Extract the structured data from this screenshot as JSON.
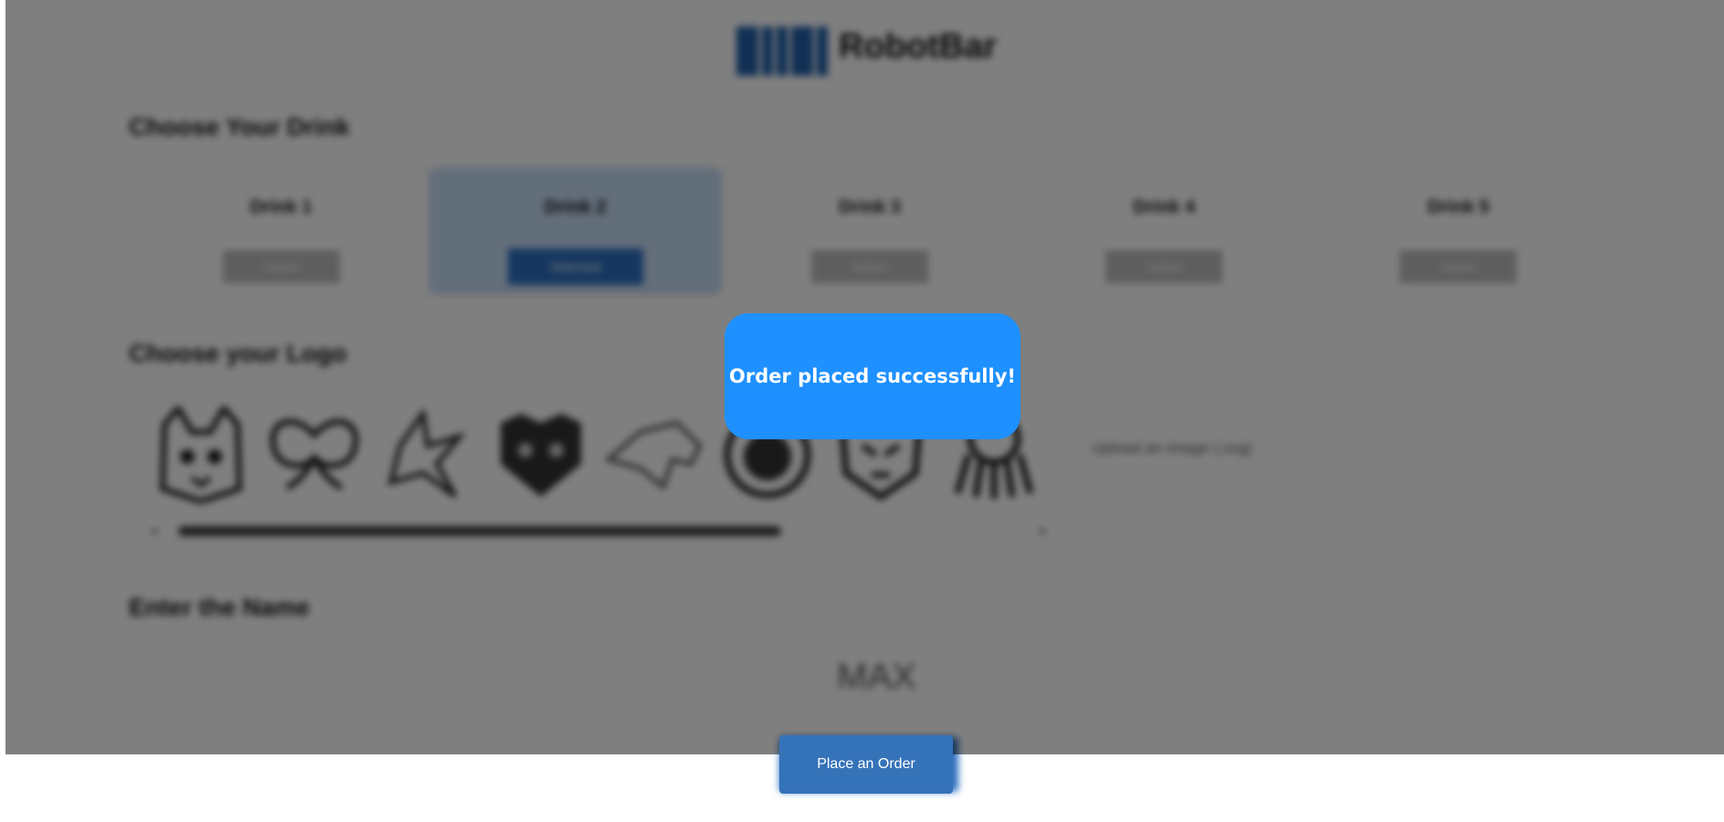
{
  "header": {
    "brand_logo": "tum-logo",
    "brand_name": "RobotBar"
  },
  "drinks_section": {
    "title": "Choose Your Drink",
    "items": [
      {
        "name": "Drink 1",
        "button_label": "Select",
        "selected": false
      },
      {
        "name": "Drink 2",
        "button_label": "Selected",
        "selected": true
      },
      {
        "name": "Drink 3",
        "button_label": "Select",
        "selected": false
      },
      {
        "name": "Drink 4",
        "button_label": "Select",
        "selected": false
      },
      {
        "name": "Drink 5",
        "button_label": "Select",
        "selected": false
      }
    ]
  },
  "logo_section": {
    "title": "Choose your Logo",
    "logos": [
      "cat-icon",
      "butterfly-icon",
      "bird-icon",
      "leopard-icon",
      "horse-icon",
      "lion-icon",
      "tiger-icon",
      "octopus-icon"
    ],
    "upload_hint": "Upload an image (.svg)"
  },
  "name_section": {
    "title": "Enter the Name",
    "value": "MAX"
  },
  "toast": {
    "message": "Order placed successfully!"
  },
  "actions": {
    "place_order_label": "Place an Order"
  },
  "colors": {
    "accent": "#2c6fc1",
    "toast_bg": "#1e90ff",
    "overlay": "rgba(0,0,0,0.5)"
  }
}
